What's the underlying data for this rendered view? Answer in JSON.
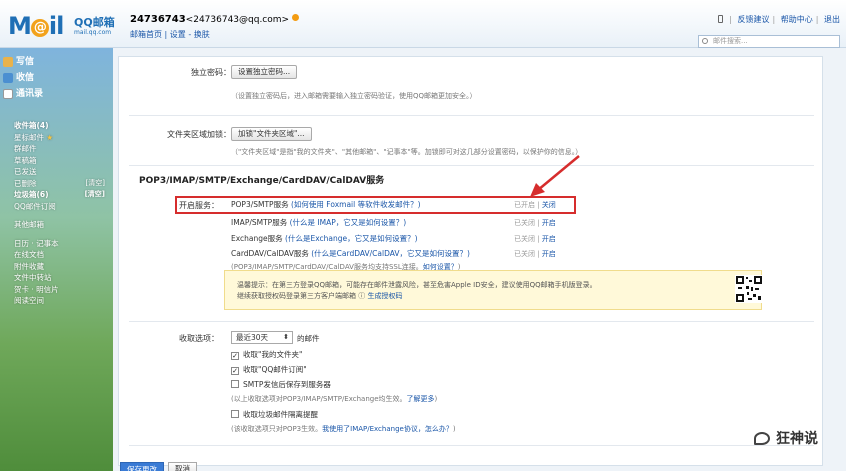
{
  "header": {
    "logo_text": "Mail",
    "logo_cn": "QQ邮箱",
    "logo_sub": "mail.qq.com",
    "user_id": "24736743",
    "user_email": "<24736743@qq.com>",
    "user_links": "邮箱首页 | 设置 - 换肤",
    "right_links": [
      "反馈建议",
      "帮助中心",
      "退出"
    ],
    "search_placeholder": "邮件搜索..."
  },
  "sidebar": {
    "actions": [
      {
        "label": "写信",
        "icon": "pencil-icon"
      },
      {
        "label": "收信",
        "icon": "inbox-icon"
      },
      {
        "label": "通讯录",
        "icon": "contacts-icon"
      }
    ],
    "folders": [
      {
        "label": "收件箱(4)",
        "bold": true
      },
      {
        "label": "星标邮件",
        "star": "★"
      },
      {
        "label": "群邮件"
      },
      {
        "label": "草稿箱"
      },
      {
        "label": "已发送"
      },
      {
        "label": "已删除",
        "clear": "[清空]"
      },
      {
        "label": "垃圾箱(6)",
        "bold": true,
        "clear": "[清空]"
      },
      {
        "label": "QQ邮件订阅"
      }
    ],
    "other": [
      {
        "label": "其他邮箱"
      }
    ],
    "tools": [
      {
        "label": "日历 · 记事本"
      },
      {
        "label": "在线文档"
      },
      {
        "label": "附件收藏"
      },
      {
        "label": "文件中转站"
      },
      {
        "label": "贺卡 · 明信片"
      },
      {
        "label": "阅读空间"
      }
    ]
  },
  "settings": {
    "independent_pwd": {
      "label": "独立密码：",
      "button": "设置独立密码...",
      "note": "（设置独立密码后，进入邮箱需要输入独立密码验证，使用QQ邮箱更加安全。）"
    },
    "folder_encrypt": {
      "label": "文件夹区域加锁：",
      "button": "加锁\"文件夹区域\"...",
      "note": "（\"文件夹区域\"是指\"我的文件夹\"、\"其他邮箱\"、\"记事本\"等。加锁即可对这几部分设置密码，以保护你的信息。）"
    },
    "pop_section_title": "POP3/IMAP/SMTP/Exchange/CardDAV/CalDAV服务",
    "enable_label": "开启服务：",
    "services": [
      {
        "name": "POP3/SMTP服务",
        "link": "(如何使用 Foxmail 等软件收发邮件？)",
        "status": "已开启",
        "action": "关闭"
      },
      {
        "name": "IMAP/SMTP服务",
        "link": "(什么是 IMAP，它又是如何设置？)",
        "status": "已关闭",
        "action": "开启"
      },
      {
        "name": "Exchange服务",
        "link": "(什么是Exchange，它又是如何设置？)",
        "status": "已关闭",
        "action": "开启"
      },
      {
        "name": "CardDAV/CalDAV服务",
        "link": "(什么是CardDAV/CalDAV，它又是如何设置？)",
        "status": "已关闭",
        "action": "开启"
      }
    ],
    "ssl_note": "(POP3/IMAP/SMTP/CardDAV/CalDAV服务均支持SSL连接。",
    "ssl_link": "如何设置？",
    "warning_line1": "温馨提示：在第三方登录QQ邮箱，可能存在邮件泄露风险，甚至危害Apple ID安全，建议使用QQ邮箱手机版登录。",
    "warning_line2": "继续获取授权码登录第三方客户端邮箱",
    "warning_link": "生成授权码",
    "receive_label": "收取选项：",
    "receive_select": "最近30天",
    "receive_suffix": "的邮件",
    "checkboxes": [
      {
        "label": "收取\"我的文件夹\"",
        "checked": true
      },
      {
        "label": "收取\"QQ邮件订阅\"",
        "checked": true
      },
      {
        "label": "SMTP发信后保存到服务器",
        "checked": false
      }
    ],
    "receive_note": "(以上收取选项对POP3/IMAP/SMTP/Exchange均生效。",
    "receive_note_link": "了解更多",
    "junk_checkbox": {
      "label": "收取垃圾邮件隔离提醒",
      "checked": false
    },
    "junk_note": "(该收取选项只对POP3生效。",
    "junk_note_link": "我使用了IMAP/Exchange协议，怎么办？"
  },
  "footer": {
    "save": "保存更改",
    "cancel": "取消"
  },
  "watermark": "狂神说"
}
